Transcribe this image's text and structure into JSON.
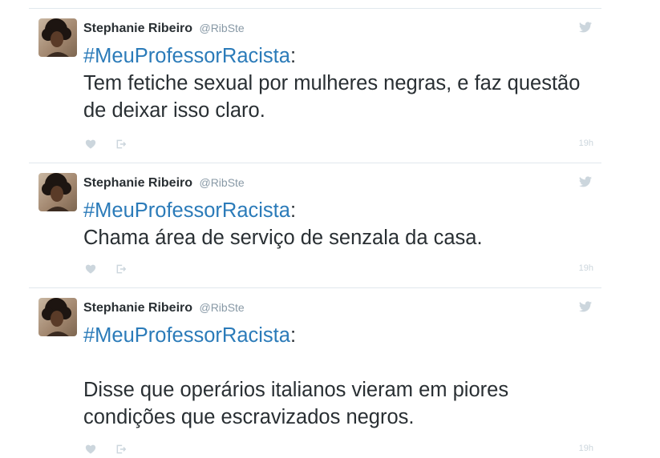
{
  "tweets": [
    {
      "author_name": "Stephanie Ribeiro",
      "author_handle": "@RibSte",
      "hashtag": "#MeuProfessorRacista",
      "colon": ":",
      "body": "Tem fetiche sexual por mulheres negras, e faz questão de deixar isso claro.",
      "time": "19h"
    },
    {
      "author_name": "Stephanie Ribeiro",
      "author_handle": "@RibSte",
      "hashtag": "#MeuProfessorRacista",
      "colon": ":",
      "body": "Chama área de serviço de senzala da casa.",
      "time": "19h"
    },
    {
      "author_name": "Stephanie Ribeiro",
      "author_handle": "@RibSte",
      "hashtag": "#MeuProfessorRacista",
      "colon": ":",
      "body": "\nDisse que operários italianos vieram em piores condições que escravizados negros.",
      "time": "19h"
    }
  ],
  "colors": {
    "hashtag": "#2b7bb9",
    "text": "#292f33",
    "muted": "#8899a6",
    "faint": "#ccd6dd",
    "divider": "#e1e8ed"
  },
  "icons": [
    "twitter-bird-icon",
    "heart-icon",
    "share-icon"
  ]
}
